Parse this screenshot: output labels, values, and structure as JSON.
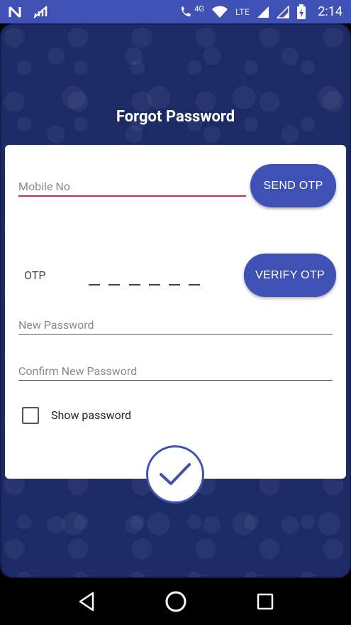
{
  "status_bar": {
    "time": "2:14",
    "network": "4G",
    "lte_label": "LTE"
  },
  "screen": {
    "title": "Forgot Password"
  },
  "form": {
    "mobile_placeholder": "Mobile No",
    "send_otp_label": "SEND OTP",
    "otp_label": "OTP",
    "otp_digits": 6,
    "verify_otp_label": "VERIFY OTP",
    "new_password_placeholder": "New Password",
    "confirm_password_placeholder": "Confirm New Password",
    "show_password_label": "Show password",
    "show_password_checked": false
  },
  "colors": {
    "primary": "#3f51b5",
    "accent": "#e91e63",
    "background": "#1c2a66"
  },
  "icons": {
    "submit": "check-icon",
    "nav_back": "back-icon",
    "nav_home": "home-icon",
    "nav_recents": "recents-icon"
  }
}
